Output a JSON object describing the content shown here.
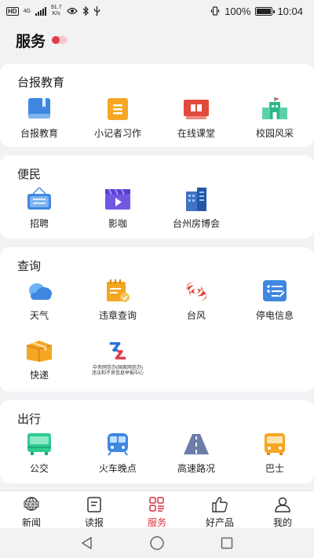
{
  "status_bar": {
    "hd": "HD",
    "net": "4G",
    "speed_value": "91.7",
    "speed_unit": "K/s",
    "battery": "100%",
    "time": "10:04"
  },
  "header": {
    "title": "服务"
  },
  "sections": {
    "education": {
      "title": "台报教育",
      "items": [
        "台报教育",
        "小记者习作",
        "在线课堂",
        "校园风采"
      ]
    },
    "convenience": {
      "title": "便民",
      "items": [
        "招聘",
        "影咖",
        "台州房博会"
      ]
    },
    "query": {
      "title": "查询",
      "items": [
        "天气",
        "违章查询",
        "台风",
        "停电信息",
        "快递"
      ],
      "report_center_lines": [
        "中央网信办(国家网信办)",
        "违法和不良信息举报中心"
      ]
    },
    "travel": {
      "title": "出行",
      "items": [
        "公交",
        "火车晚点",
        "高速路况",
        "巴士"
      ]
    }
  },
  "tabbar": {
    "items": [
      "新闻",
      "读报",
      "服务",
      "好产品",
      "我的"
    ],
    "active": "服务"
  },
  "colors": {
    "accent": "#d83440"
  }
}
